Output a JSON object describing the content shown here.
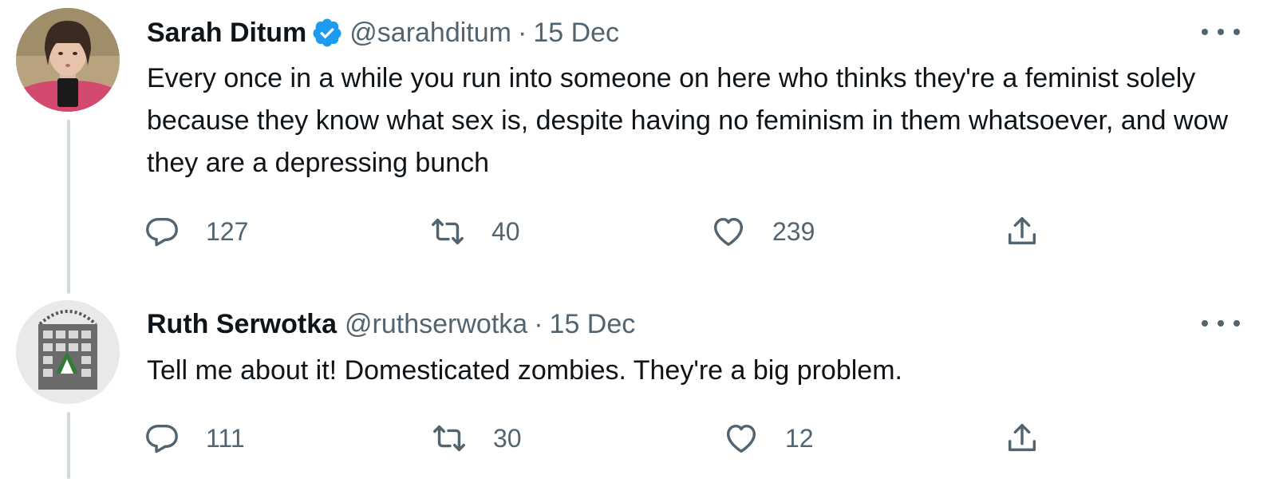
{
  "tweets": [
    {
      "author": {
        "name": "Sarah Ditum",
        "handle": "@sarahditum",
        "verified": true
      },
      "separator": "·",
      "date": "15 Dec",
      "text": "Every once in a while you run into someone on here who thinks they're a feminist solely because they know what sex is, despite having no feminism in them whatsoever, and wow they are a depressing bunch",
      "counts": {
        "replies": "127",
        "retweets": "40",
        "likes": "239"
      }
    },
    {
      "author": {
        "name": "Ruth Serwotka",
        "handle": "@ruthserwotka",
        "verified": false
      },
      "separator": "·",
      "date": "15 Dec",
      "text": "Tell me about it! Domesticated zombies.  They're a big problem.",
      "counts": {
        "replies": "111",
        "retweets": "30",
        "likes": "12"
      }
    }
  ],
  "colors": {
    "verified": "#1d9bf0",
    "secondary_text": "#536471",
    "thread_line": "#cfd9de"
  },
  "icons": [
    "reply-icon",
    "retweet-icon",
    "like-icon",
    "share-icon",
    "more-icon",
    "verified-badge-icon"
  ]
}
